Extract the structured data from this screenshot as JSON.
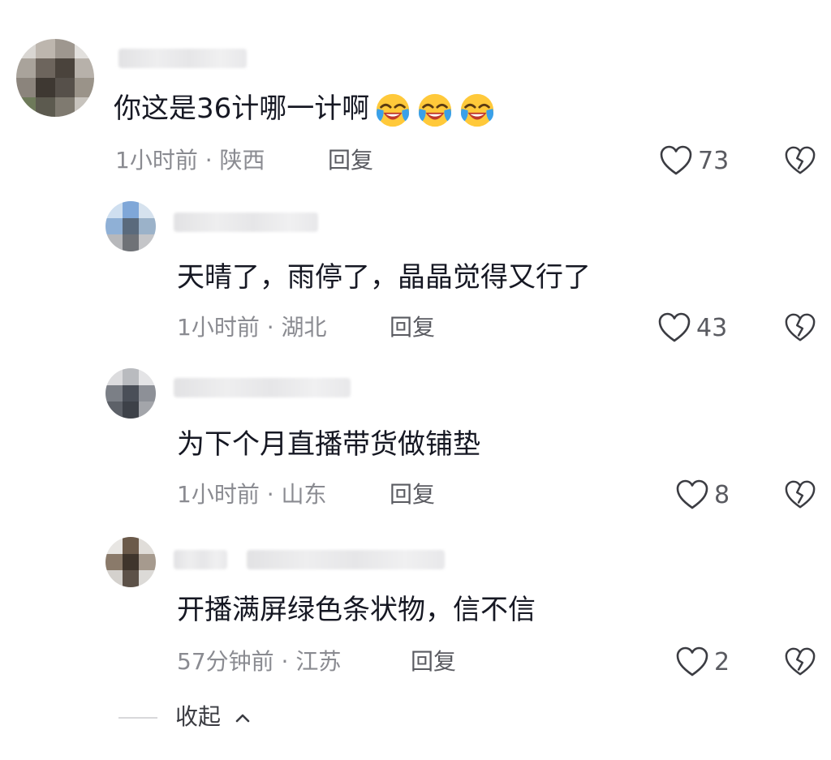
{
  "comments": [
    {
      "text": "你这是36计哪一计啊",
      "emojis": [
        "laughing-crying-emoji",
        "laughing-crying-emoji",
        "laughing-crying-emoji"
      ],
      "time": "1小时前 · 陕西",
      "reply_label": "回复",
      "likes": "73"
    },
    {
      "text": "天晴了，雨停了，晶晶觉得又行了",
      "time": "1小时前 · 湖北",
      "reply_label": "回复",
      "likes": "43"
    },
    {
      "text": "为下个月直播带货做铺垫",
      "time": "1小时前 · 山东",
      "reply_label": "回复",
      "likes": "8"
    },
    {
      "text": "开播满屏绿色条状物，信不信",
      "time": "57分钟前 · 江苏",
      "reply_label": "回复",
      "likes": "2"
    }
  ],
  "collapse_label": "收起",
  "colors": {
    "text_primary": "#161823",
    "text_meta": "#8a8b91",
    "text_action": "#5a5b61",
    "icon_stroke": "#3b3c42",
    "background": "#ffffff"
  },
  "icons": {
    "like": "heart-outline-icon",
    "dislike": "broken-heart-icon",
    "collapse": "chevron-up-icon"
  }
}
